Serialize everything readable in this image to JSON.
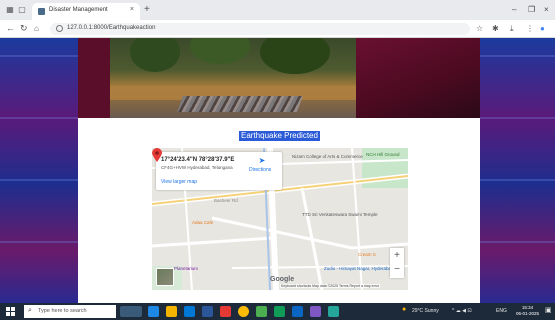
{
  "browser": {
    "tab_title": "Disaster Management",
    "tab_close": "×",
    "new_tab": "+",
    "url": "127.0.0.1:8000/Earthquakeaction",
    "win_min": "–",
    "win_max": "❐",
    "win_close": "×"
  },
  "page": {
    "prediction": "Earthquake Predicted"
  },
  "map": {
    "coordinates": "17°24'23.4\"N 78°28'37.9\"E",
    "address": "CF4G+HVW Hyderabad, Telangana",
    "directions_label": "Directions",
    "larger_map_link": "View larger map",
    "labels": {
      "arts_college": "Nizam College of Arts & Commerce",
      "temple": "TTD Sri Venkateswara Swami Temple",
      "adaa_cafe": "Adaa Cafe",
      "planetarium": "Planetarium",
      "zudio": "Zudio - Himayat Nagar, Hyderabad",
      "cream": "Cream S",
      "ground": "NCH Hill Ground",
      "road": "Basheer Rd"
    },
    "zoom_in": "+",
    "zoom_out": "−",
    "footer": "Keyboard shortcuts   Map data ©2025   Terms   Report a map error",
    "google": "Google"
  },
  "taskbar": {
    "search_placeholder": "Type here to search",
    "weather": "29°C  Sunny",
    "tray_lang": "ENG",
    "time": "15:34",
    "date": "06-01-2025"
  },
  "colors": {
    "highlight": "#2b5bd6",
    "taskbar": "#1d2a3a",
    "pin": "#e53935"
  }
}
